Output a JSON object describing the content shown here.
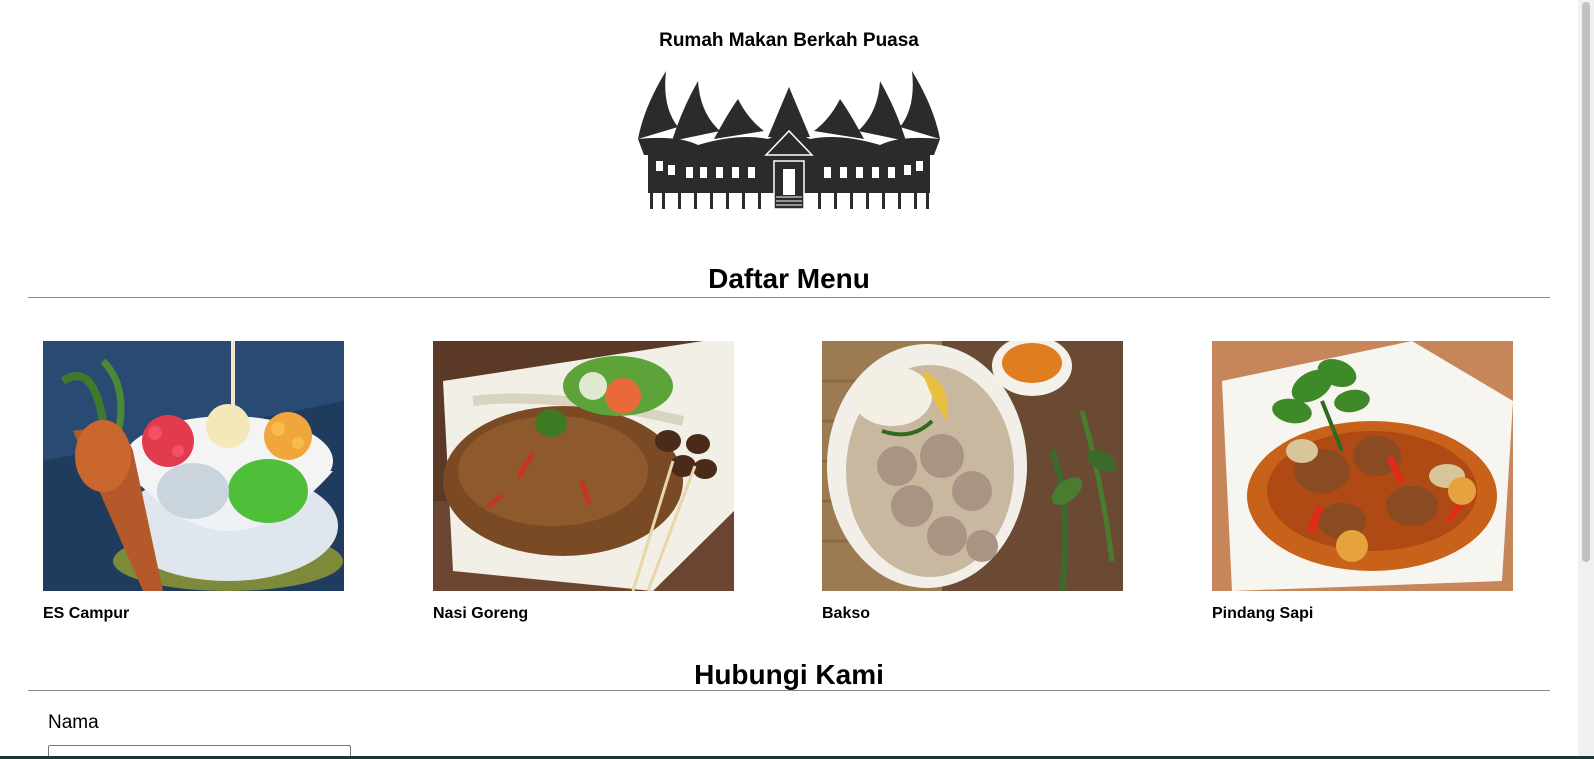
{
  "header": {
    "title": "Rumah Makan Berkah Puasa",
    "logo_icon": "rumah-gadang-logo-icon"
  },
  "menu_section": {
    "title": "Daftar Menu",
    "items": [
      {
        "name": "ES Campur",
        "photo": "es-campur-photo"
      },
      {
        "name": "Nasi Goreng",
        "photo": "nasi-goreng-photo"
      },
      {
        "name": "Bakso",
        "photo": "bakso-photo"
      },
      {
        "name": "Pindang Sapi",
        "photo": "pindang-sapi-photo"
      }
    ]
  },
  "contact_section": {
    "title": "Hubungi Kami",
    "name_label": "Nama",
    "name_value": ""
  }
}
